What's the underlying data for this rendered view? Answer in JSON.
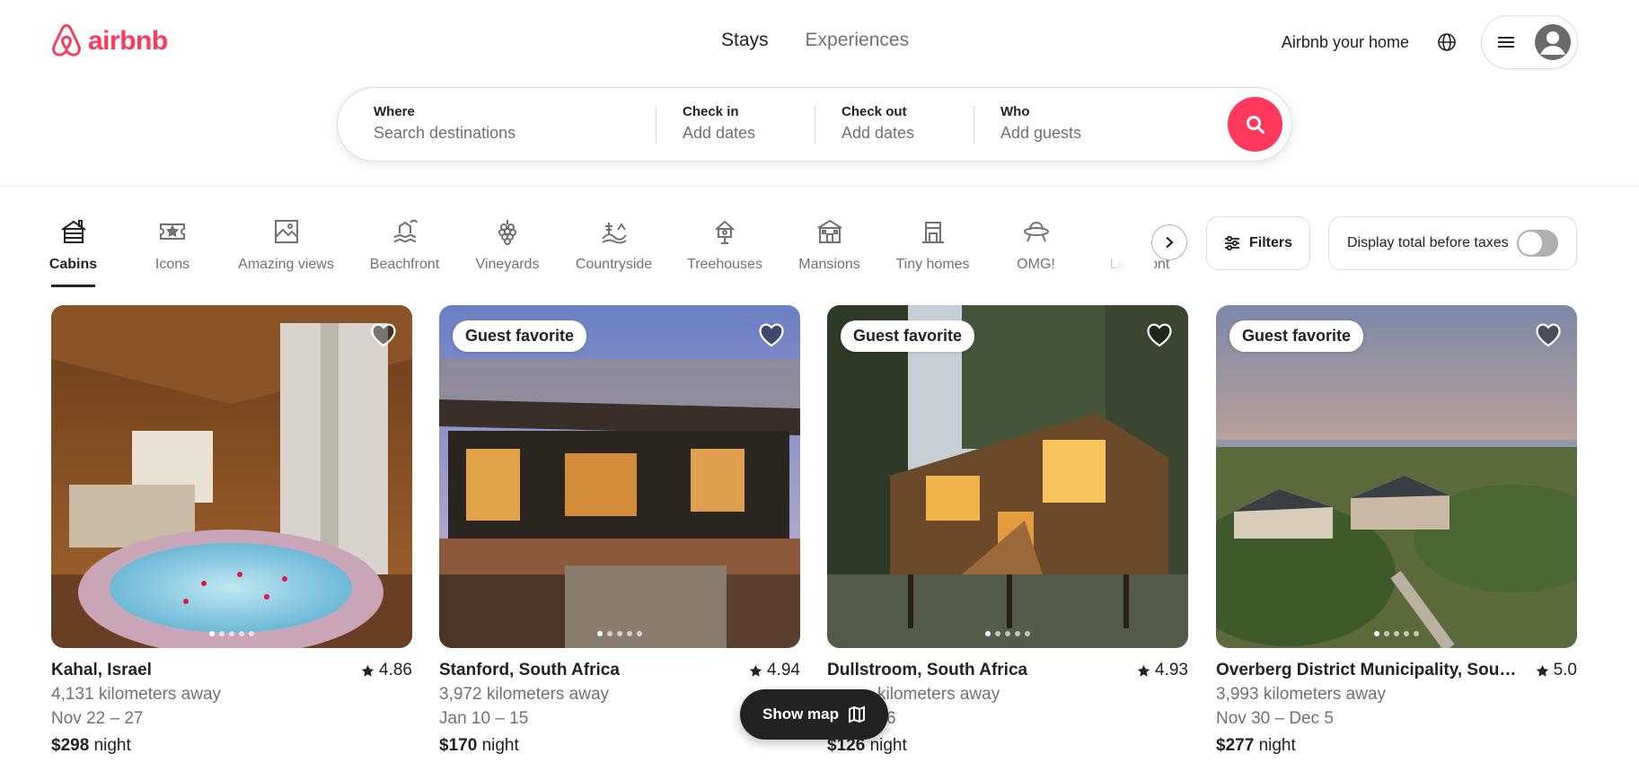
{
  "brand": {
    "name": "airbnb",
    "color": "#ff385c"
  },
  "nav": {
    "tabs": [
      {
        "label": "Stays"
      },
      {
        "label": "Experiences"
      }
    ]
  },
  "header_right": {
    "host_label": "Airbnb your home"
  },
  "search": {
    "where": {
      "label": "Where",
      "placeholder": "Search destinations"
    },
    "checkin": {
      "label": "Check in",
      "value": "Add dates"
    },
    "checkout": {
      "label": "Check out",
      "value": "Add dates"
    },
    "who": {
      "label": "Who",
      "value": "Add guests"
    }
  },
  "categories": [
    {
      "label": "Cabins",
      "icon": "cabin-icon",
      "active": true
    },
    {
      "label": "Icons",
      "icon": "ticket-star-icon"
    },
    {
      "label": "Amazing views",
      "icon": "view-frame-icon"
    },
    {
      "label": "Beachfront",
      "icon": "beach-icon"
    },
    {
      "label": "Vineyards",
      "icon": "grapes-icon"
    },
    {
      "label": "Countryside",
      "icon": "countryside-icon"
    },
    {
      "label": "Treehouses",
      "icon": "treehouse-icon"
    },
    {
      "label": "Mansions",
      "icon": "mansion-icon"
    },
    {
      "label": "Tiny homes",
      "icon": "tiny-home-icon"
    },
    {
      "label": "OMG!",
      "icon": "ufo-icon"
    },
    {
      "label": "Lakefront",
      "icon": "lakefront-icon"
    }
  ],
  "filters_label": "Filters",
  "tax_toggle": {
    "label": "Display total before taxes",
    "on": false
  },
  "listings": [
    {
      "badge": "",
      "title": "Kahal, Israel",
      "rating": "4.86",
      "distance": "4,131 kilometers away",
      "dates": "Nov 22 – 27",
      "price": "$298",
      "price_unit": "night"
    },
    {
      "badge": "Guest favorite",
      "title": "Stanford, South Africa",
      "rating": "4.94",
      "distance": "3,972 kilometers away",
      "dates": "Jan 10 – 15",
      "price": "$170",
      "price_unit": "night"
    },
    {
      "badge": "Guest favorite",
      "title": "Dullstroom, South Africa",
      "rating": "4.93",
      "distance": "kilometers away",
      "dates": "6",
      "price": "$126",
      "price_unit": "night"
    },
    {
      "badge": "Guest favorite",
      "title": "Overberg District Municipality, South ...",
      "rating": "5.0",
      "distance": "3,993 kilometers away",
      "dates": "Nov 30 – Dec 5",
      "price": "$277",
      "price_unit": "night"
    }
  ],
  "show_map": {
    "label": "Show map"
  }
}
